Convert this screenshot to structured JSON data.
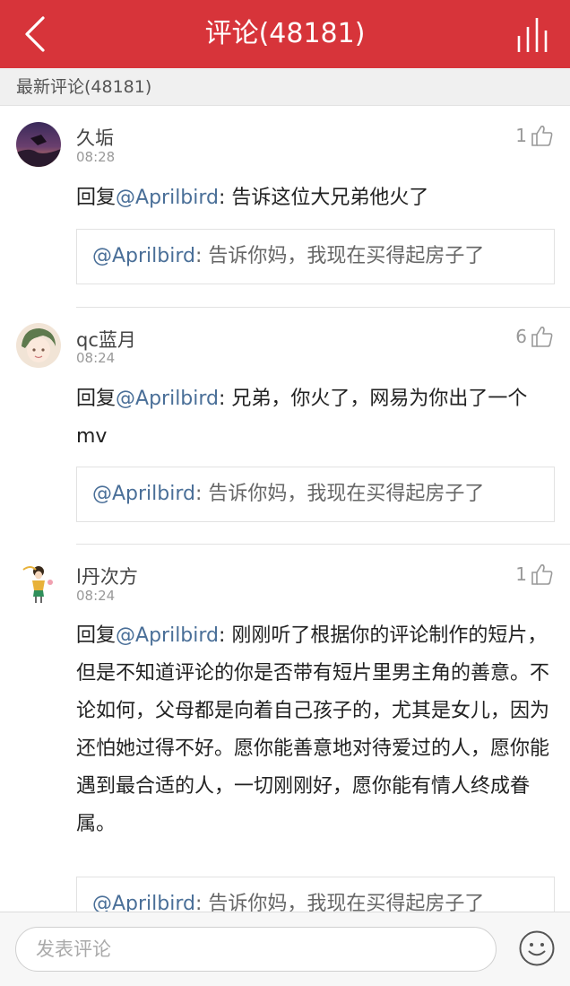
{
  "header": {
    "title": "评论(48181)",
    "back_icon": "chevron-left-icon",
    "stats_icon": "bar-chart-icon",
    "background_color": "#d7343a"
  },
  "section": {
    "label": "最新评论(48181)"
  },
  "comments": [
    {
      "name": "久垢",
      "time": "08:28",
      "likes": "1",
      "reply_prefix": "回复",
      "mention": "@Aprilbird",
      "text": ": 告诉这位大兄弟他火了",
      "quote_mention": "@Aprilbird",
      "quote_text": ": 告诉你妈，我现在买得起房子了"
    },
    {
      "name": "qc蓝月",
      "time": "08:24",
      "likes": "6",
      "reply_prefix": "回复",
      "mention": "@Aprilbird",
      "text": ": 兄弟，你火了，网易为你出了一个mv",
      "quote_mention": "@Aprilbird",
      "quote_text": ": 告诉你妈，我现在买得起房子了"
    },
    {
      "name": "l丹次方",
      "time": "08:24",
      "likes": "1",
      "reply_prefix": "回复",
      "mention": "@Aprilbird",
      "text": ": 刚刚听了根据你的评论制作的短片，但是不知道评论的你是否带有短片里男主角的善意。不论如何，父母都是向着自己孩子的，尤其是女儿，因为还怕她过得不好。愿你能善意地对待爱过的人，愿你能遇到最合适的人，一切刚刚好，愿你能有情人终成眷属。",
      "quote_mention": "@Aprilbird",
      "quote_text": ": 告诉你妈，我现在买得起房子了"
    }
  ],
  "bottom": {
    "input_placeholder": "发表评论",
    "emoji_icon": "smiley-face-icon"
  },
  "colors": {
    "mention": "#4a6f98",
    "divider": "#e2e2e2"
  }
}
